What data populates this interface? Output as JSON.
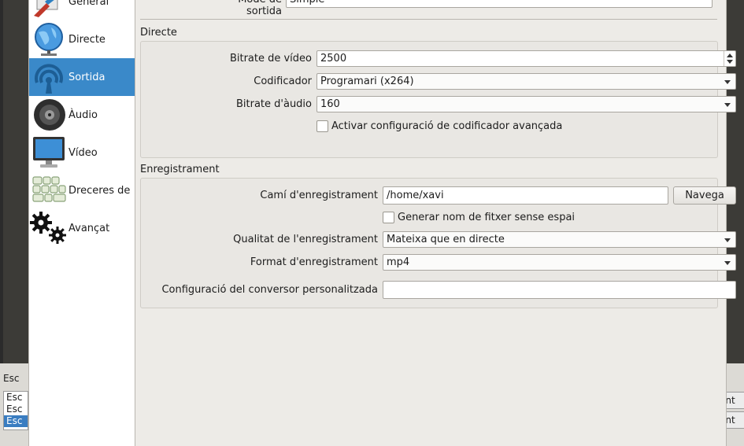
{
  "background": {
    "dock_title": "Esc",
    "list_items": [
      "Esc",
      "Esc",
      "Esc"
    ],
    "right_buttons": [
      "ent",
      "ent"
    ]
  },
  "sidebar": {
    "items": [
      {
        "label": "General",
        "icon": "general-icon"
      },
      {
        "label": "Directe",
        "icon": "globe-icon"
      },
      {
        "label": "Sortida",
        "icon": "broadcast-icon"
      },
      {
        "label": "Àudio",
        "icon": "speaker-icon"
      },
      {
        "label": "Vídeo",
        "icon": "monitor-icon"
      },
      {
        "label": "Dreceres de",
        "icon": "keyboard-icon"
      },
      {
        "label": "Avançat",
        "icon": "gears-icon"
      }
    ],
    "active": "Sortida",
    "accent": "#3a89c9"
  },
  "output_mode": {
    "label": "Mode de sortida",
    "value": "Simple"
  },
  "streaming": {
    "title": "Directe",
    "video_bitrate_label": "Bitrate de vídeo",
    "video_bitrate_value": "2500",
    "encoder_label": "Codificador",
    "encoder_value": "Programari (x264)",
    "audio_bitrate_label": "Bitrate d'àudio",
    "audio_bitrate_value": "160",
    "advanced_label": "Activar configuració de codificador avançada"
  },
  "recording": {
    "title": "Enregistrament",
    "path_label": "Camí d'enregistrament",
    "path_value": "/home/xavi",
    "browse_label": "Navega",
    "nospace_label": "Generar nom de fitxer sense espai",
    "quality_label": "Qualitat de l'enregistrament",
    "quality_value": "Mateixa que en directe",
    "format_label": "Format d'enregistrament",
    "format_value": "mp4",
    "muxer_label": "Configuració del conversor personalitzada",
    "muxer_value": ""
  }
}
